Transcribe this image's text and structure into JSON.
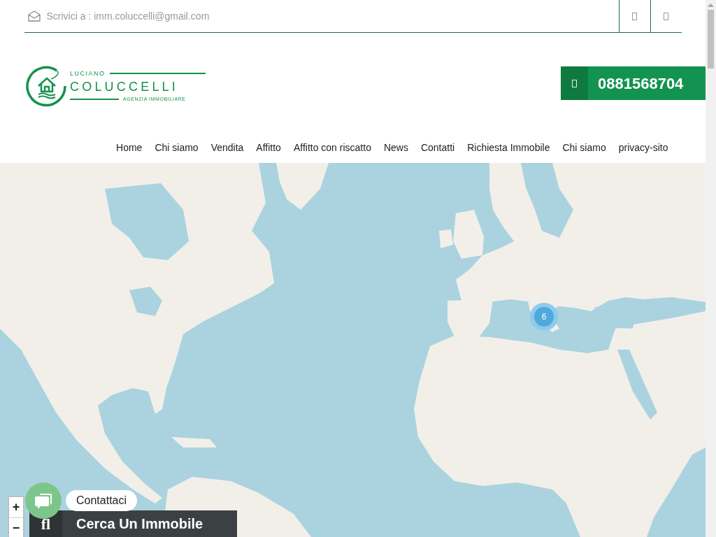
{
  "top_bar": {
    "email_label": "Scrivici a : imm.coluccelli@gmail.com"
  },
  "logo": {
    "line_1": "LUCIANO",
    "line_2": "COLUCCELLI",
    "line_3": "AGENZIA IMMOBILIARE"
  },
  "phone_button": {
    "number": "0881568704"
  },
  "nav": {
    "items": [
      "Home",
      "Chi siamo",
      "Vendita",
      "Affitto",
      "Affitto con riscatto",
      "News",
      "Contatti",
      "Richiesta Immobile",
      "Chi siamo",
      "privacy-sito"
    ]
  },
  "map": {
    "cluster": {
      "count": "6"
    },
    "zoom_controls": [
      "+",
      "−"
    ]
  },
  "chat_widget": {
    "label": "Contattaci"
  },
  "search_panel": {
    "icon_text": "fl",
    "title": "Cerca Un Immobile"
  }
}
